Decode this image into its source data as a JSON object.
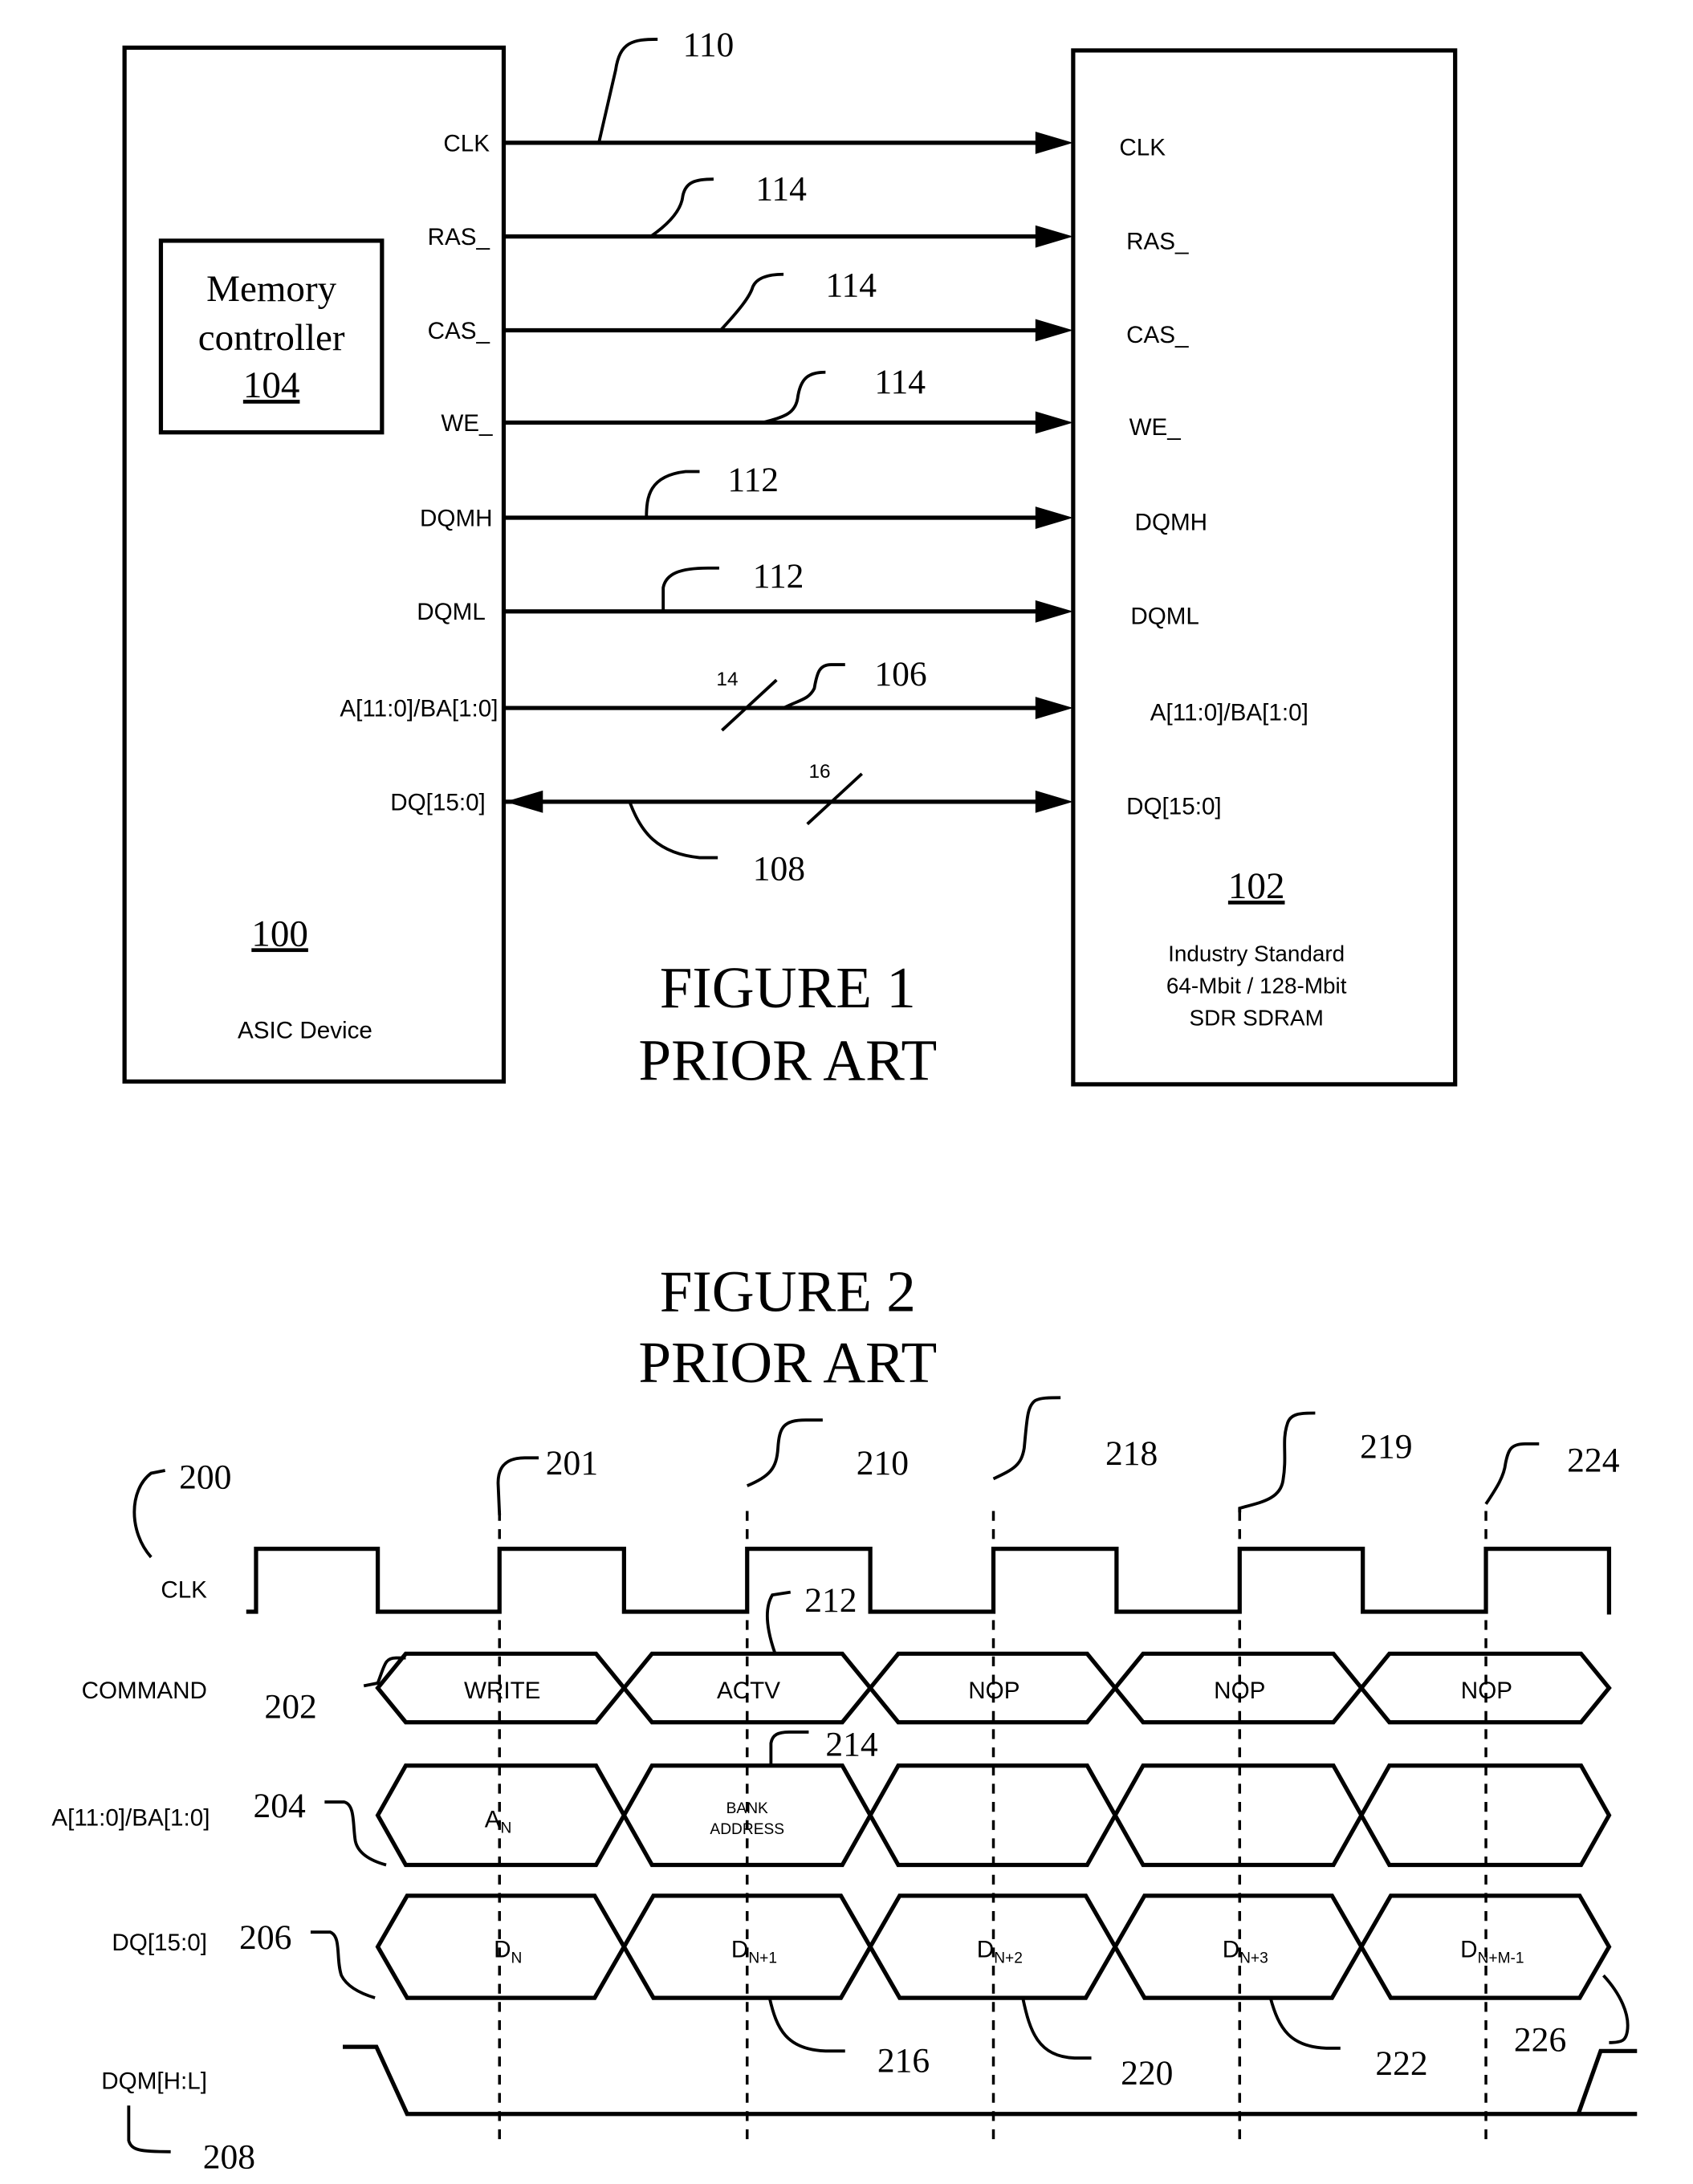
{
  "figure1": {
    "title": "FIGURE 1",
    "subtitle": "PRIOR ART",
    "asic": {
      "ref": "100",
      "label": "ASIC Device",
      "controller": {
        "line1": "Memory",
        "line2": "controller",
        "ref": "104"
      }
    },
    "sdram": {
      "ref": "102",
      "line1": "Industry Standard",
      "line2": "64-Mbit / 128-Mbit",
      "line3": "SDR SDRAM"
    },
    "signals": [
      {
        "name": "CLK",
        "ref": "110",
        "direction": "out"
      },
      {
        "name": "RAS_",
        "ref": "114",
        "direction": "out"
      },
      {
        "name": "CAS_",
        "ref": "114",
        "direction": "out"
      },
      {
        "name": "WE_",
        "ref": "114",
        "direction": "out"
      },
      {
        "name": "DQMH",
        "ref": "112",
        "direction": "out"
      },
      {
        "name": "DQML",
        "ref": "112",
        "direction": "out"
      },
      {
        "name": "A[11:0]/BA[1:0]",
        "ref": "106",
        "direction": "out",
        "bus_width": "14"
      },
      {
        "name": "DQ[15:0]",
        "ref": "108",
        "direction": "bidirectional",
        "bus_width": "16"
      }
    ]
  },
  "figure2": {
    "title": "FIGURE 2",
    "subtitle": "PRIOR ART",
    "rows": {
      "clk": {
        "label": "CLK",
        "ref": "200"
      },
      "command": {
        "label": "COMMAND",
        "ref": "202"
      },
      "addr": {
        "label": "A[11:0]/BA[1:0]",
        "ref": "204"
      },
      "dq": {
        "label": "DQ[15:0]",
        "ref": "206"
      },
      "dqm": {
        "label": "DQM[H:L]",
        "ref": "208"
      }
    },
    "edge_refs": [
      "201",
      "210",
      "218",
      "219",
      "224"
    ],
    "commands": [
      "WRITE",
      "ACTV",
      "NOP",
      "NOP",
      "NOP"
    ],
    "command_ref": "212",
    "addresses": [
      {
        "main": "A",
        "sub": "N"
      },
      {
        "line1": "BANK",
        "line2": "ADDRESS"
      },
      {
        "main": ""
      },
      {
        "main": ""
      },
      {
        "main": ""
      }
    ],
    "bank_address_ref": "214",
    "data": [
      {
        "main": "D",
        "sub": "N"
      },
      {
        "main": "D",
        "sub": "N+1"
      },
      {
        "main": "D",
        "sub": "N+2"
      },
      {
        "main": "D",
        "sub": "N+3"
      },
      {
        "main": "D",
        "sub": "N+M-1"
      }
    ],
    "data_refs": [
      "216",
      "220",
      "222",
      "226"
    ]
  }
}
